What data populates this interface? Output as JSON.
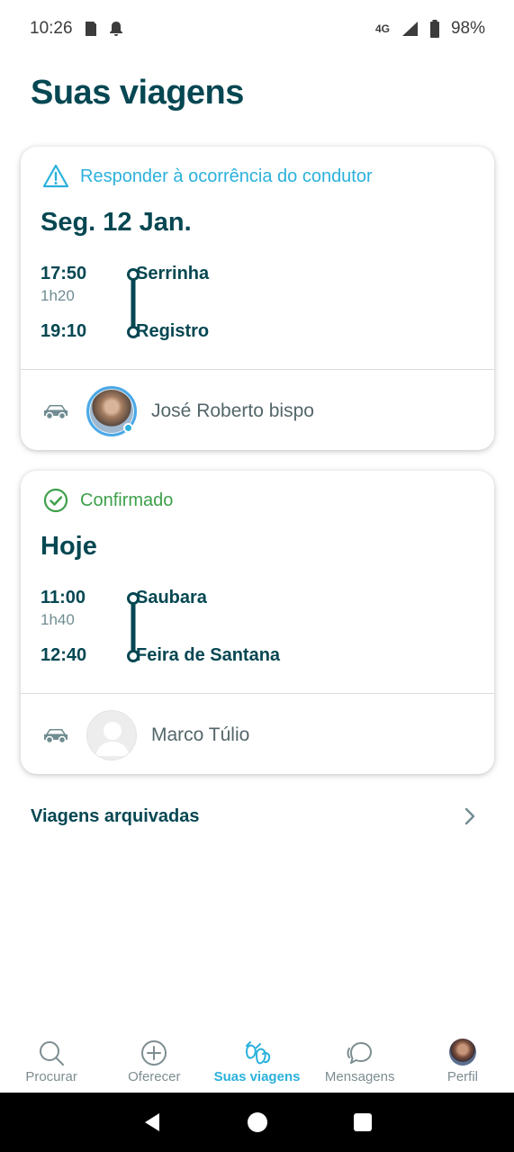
{
  "status_bar": {
    "time": "10:26",
    "network": "4G",
    "battery": "98%"
  },
  "page": {
    "title": "Suas viagens"
  },
  "trips": [
    {
      "status": "Responder à ocorrência do condutor",
      "status_icon": "warning-icon",
      "date": "Seg. 12 Jan.",
      "depart_time": "17:50",
      "duration": "1h20",
      "arrive_time": "19:10",
      "from": "Serrinha",
      "to": "Registro",
      "driver": "José Roberto bispo"
    },
    {
      "status": "Confirmado",
      "status_icon": "check-circle-icon",
      "date": "Hoje",
      "depart_time": "11:00",
      "duration": "1h40",
      "arrive_time": "12:40",
      "from": "Saubara",
      "to": "Feira de Santana",
      "driver": "Marco Túlio"
    }
  ],
  "archived": {
    "label": "Viagens arquivadas"
  },
  "bottom_nav": {
    "items": [
      {
        "label": "Procurar",
        "icon": "search-icon"
      },
      {
        "label": "Oferecer",
        "icon": "plus-circle-icon"
      },
      {
        "label": "Suas viagens",
        "icon": "trips-icon",
        "active": true
      },
      {
        "label": "Mensagens",
        "icon": "chat-icon"
      },
      {
        "label": "Perfil",
        "icon": "profile-avatar"
      }
    ]
  },
  "colors": {
    "primary": "#054752",
    "accent": "#2bb1dc",
    "success": "#3da04a",
    "muted": "#708c91"
  }
}
